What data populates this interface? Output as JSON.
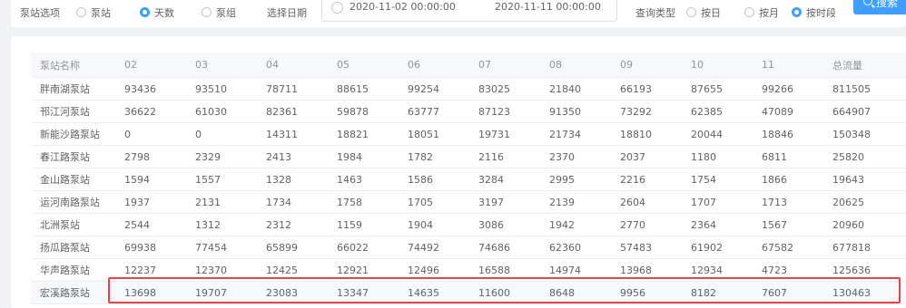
{
  "filter": {
    "label_prefix": "泵站选项",
    "option_a": "泵站",
    "option_b": "天数",
    "option_c": "泵组",
    "date_label": "选择日期",
    "date_start": "2020-11-02 00:00:00",
    "date_end": "2020-11-11 00:00:00",
    "query_label": "查询类型",
    "query_a": "按日",
    "query_b": "按月",
    "query_c": "按时段",
    "search_label": "搜索"
  },
  "table": {
    "columns": [
      "泵站名称",
      "02",
      "03",
      "04",
      "05",
      "06",
      "07",
      "08",
      "09",
      "10",
      "11",
      "总流量"
    ],
    "rows": [
      [
        "胖南湖泵站",
        "93436",
        "93510",
        "78711",
        "88615",
        "99254",
        "83025",
        "21840",
        "66193",
        "87655",
        "99266",
        "811505"
      ],
      [
        "邗江河泵站",
        "36622",
        "61030",
        "82361",
        "59878",
        "63777",
        "87123",
        "91350",
        "73292",
        "62385",
        "47089",
        "664907"
      ],
      [
        "新能沙路泵站",
        "0",
        "0",
        "14311",
        "18821",
        "18051",
        "19731",
        "21734",
        "18810",
        "20044",
        "18846",
        "150348"
      ],
      [
        "春江路泵站",
        "2798",
        "2329",
        "2413",
        "1984",
        "1782",
        "2116",
        "2370",
        "2037",
        "1180",
        "6811",
        "25820"
      ],
      [
        "金山路泵站",
        "1594",
        "1557",
        "1328",
        "1463",
        "1586",
        "3284",
        "2995",
        "2216",
        "1754",
        "1866",
        "19643"
      ],
      [
        "运河南路泵站",
        "1937",
        "2131",
        "1734",
        "1758",
        "1705",
        "3197",
        "2139",
        "2604",
        "1707",
        "1713",
        "20625"
      ],
      [
        "北洲泵站",
        "2544",
        "1312",
        "2312",
        "1159",
        "1904",
        "3086",
        "1942",
        "2770",
        "2364",
        "1567",
        "20960"
      ],
      [
        "扬瓜路泵站",
        "69938",
        "77454",
        "65899",
        "66022",
        "74492",
        "74686",
        "62360",
        "57483",
        "61902",
        "67582",
        "677818"
      ],
      [
        "华声路泵站",
        "12237",
        "12370",
        "12425",
        "12921",
        "12496",
        "16588",
        "14974",
        "13968",
        "12934",
        "4723",
        "125636"
      ],
      [
        "宏溪路泵站",
        "13698",
        "19707",
        "23083",
        "13347",
        "14635",
        "11600",
        "8648",
        "9956",
        "8182",
        "7607",
        "130463"
      ]
    ]
  },
  "colors": {
    "accent": "#409eff",
    "highlight": "#e5434b"
  }
}
